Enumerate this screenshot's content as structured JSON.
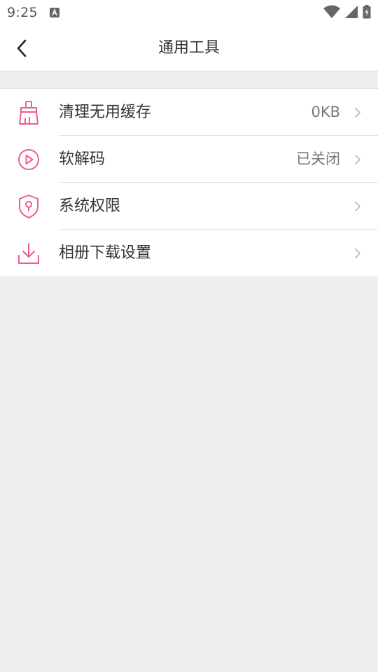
{
  "status_bar": {
    "time": "9:25",
    "notification_icon": "a-notification-icon",
    "icons": [
      "wifi-icon",
      "cellular-signal-icon",
      "battery-charging-icon"
    ]
  },
  "header": {
    "title": "通用工具",
    "back_icon": "chevron-left-icon"
  },
  "colors": {
    "accent": "#ee5d86",
    "text": "#333333",
    "secondary_text": "#777777",
    "background": "#efefef"
  },
  "items": [
    {
      "label": "清理无用缓存",
      "value": "0KB",
      "icon": "broom-icon"
    },
    {
      "label": "软解码",
      "value": "已关闭",
      "icon": "play-circle-icon"
    },
    {
      "label": "系统权限",
      "value": "",
      "icon": "shield-lock-icon"
    },
    {
      "label": "相册下载设置",
      "value": "",
      "icon": "download-icon"
    }
  ]
}
